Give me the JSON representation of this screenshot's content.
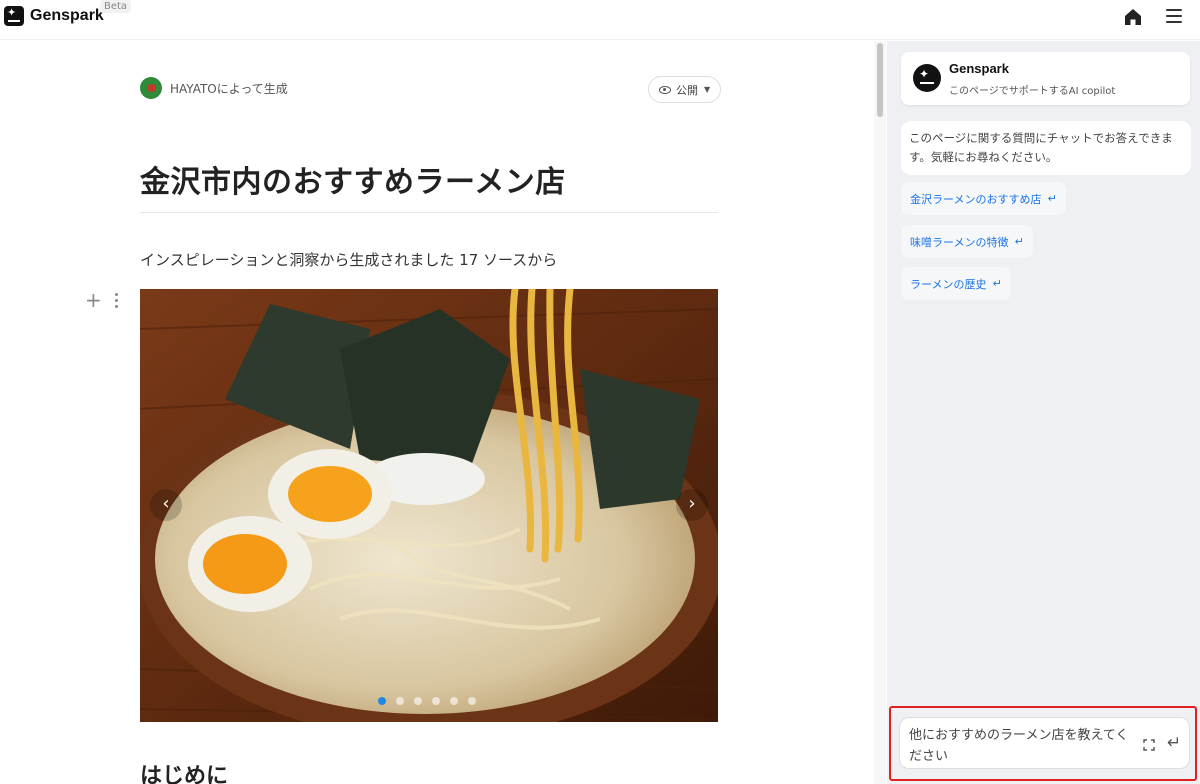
{
  "app": {
    "name": "Genspark",
    "badge": "Beta"
  },
  "header": {
    "home_icon": "home-icon",
    "menu_icon": "hamburger-menu-icon"
  },
  "page": {
    "author_text": "HAYATOによって生成",
    "visibility_label": "公開",
    "title": "金沢市内のおすすめラーメン店",
    "subtitle": "インスピレーションと洞察から生成されました 17 ソースから",
    "carousel": {
      "prev": "‹",
      "next": "›",
      "slide_count": 6,
      "active_index": 0
    },
    "section_heading": "はじめに"
  },
  "sidebar": {
    "copilot_name": "Genspark",
    "copilot_desc": "このページでサポートするAI copilot",
    "intro": "このページに関する質問にチャットでお答えできます。気軽にお尋ねください。",
    "suggestions": [
      "金沢ラーメンのおすすめ店",
      "味噌ラーメンの特徴",
      "ラーメンの歴史"
    ],
    "input_value": "他におすすめのラーメン店を教えてください"
  },
  "colors": {
    "accent": "#1a73e8",
    "highlight": "#e12020",
    "sidebar_bg": "#eef0f3"
  }
}
